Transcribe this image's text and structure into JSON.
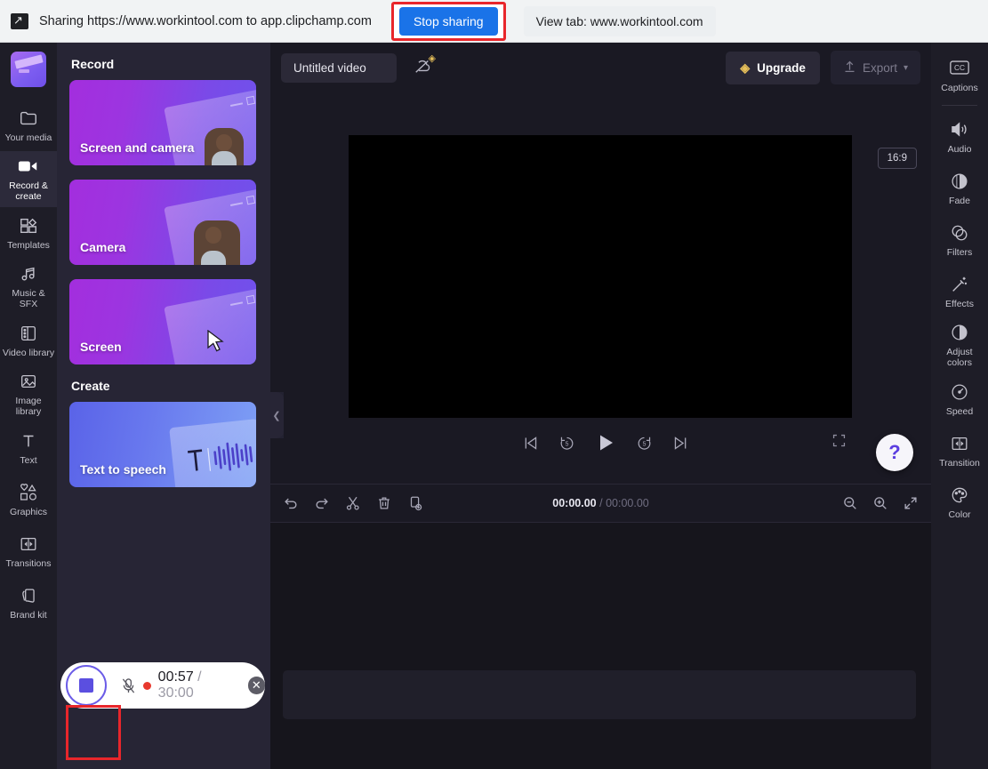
{
  "browser_bar": {
    "share_icon": "screen-share-icon",
    "sharing_text": "Sharing https://www.workintool.com to app.clipchamp.com",
    "stop_sharing_label": "Stop sharing",
    "view_tab_label": "View tab: www.workintool.com",
    "highlight_color": "#e8262b",
    "button_color": "#1a73e8"
  },
  "left_rail": {
    "logo_name": "clipchamp-logo",
    "items": [
      {
        "label": "Your media",
        "icon": "folder-icon",
        "active": false
      },
      {
        "label": "Record &\ncreate",
        "icon": "video-camera-icon",
        "active": true
      },
      {
        "label": "Templates",
        "icon": "templates-icon",
        "active": false
      },
      {
        "label": "Music & SFX",
        "icon": "music-note-icon",
        "active": false
      },
      {
        "label": "Video library",
        "icon": "film-strip-icon",
        "active": false
      },
      {
        "label": "Image\nlibrary",
        "icon": "image-icon",
        "active": false
      },
      {
        "label": "Text",
        "icon": "text-t-icon",
        "active": false
      },
      {
        "label": "Graphics",
        "icon": "shapes-icon",
        "active": false
      },
      {
        "label": "Transitions",
        "icon": "transition-icon",
        "active": false
      },
      {
        "label": "Brand kit",
        "icon": "brand-kit-icon",
        "active": false
      }
    ]
  },
  "panel": {
    "record_heading": "Record",
    "create_heading": "Create",
    "cards": [
      {
        "label": "Screen and camera",
        "art": "screen-and-person"
      },
      {
        "label": "Camera",
        "art": "person"
      },
      {
        "label": "Screen",
        "art": "screen-and-cursor"
      }
    ],
    "create_cards": [
      {
        "label": "Text to speech",
        "art": "text-waveform"
      }
    ],
    "collapse_icon": "chevron-left-icon"
  },
  "topbar": {
    "project_title": "Untitled video",
    "cloud_icon": "cloud-off-icon",
    "cloud_badge_icon": "gem-icon",
    "upgrade_label": "Upgrade",
    "upgrade_icon": "gem-icon",
    "export_label": "Export",
    "export_icon": "upload-arrow-icon",
    "export_chevron": "chevron-down-icon"
  },
  "preview": {
    "aspect_ratio": "16:9",
    "background_color": "#000000"
  },
  "playback": {
    "skip_start_icon": "skip-to-start-icon",
    "back5_icon": "rewind-5-icon",
    "play_icon": "play-icon",
    "fwd5_icon": "forward-5-icon",
    "skip_end_icon": "skip-to-end-icon",
    "fullscreen_icon": "fullscreen-icon"
  },
  "help": {
    "icon": "question-mark-icon",
    "label": "?"
  },
  "timeline_toolbar": {
    "undo_icon": "undo-icon",
    "redo_icon": "redo-icon",
    "split_icon": "scissors-icon",
    "delete_icon": "trash-icon",
    "duplicate_icon": "add-clip-icon",
    "current_time": "00:00.00",
    "separator": "/",
    "total_time": "00:00.00",
    "zoom_out_icon": "zoom-out-icon",
    "zoom_in_icon": "zoom-in-icon",
    "fit_icon": "fit-to-screen-icon"
  },
  "center_collapse_icon": "chevron-left-icon",
  "right_rail": {
    "items": [
      {
        "label": "Captions",
        "icon": "cc-icon"
      },
      {
        "label": "Audio",
        "icon": "speaker-icon"
      },
      {
        "label": "Fade",
        "icon": "fade-icon"
      },
      {
        "label": "Filters",
        "icon": "filters-icon"
      },
      {
        "label": "Effects",
        "icon": "magic-wand-icon"
      },
      {
        "label": "Adjust\ncolors",
        "icon": "contrast-icon"
      },
      {
        "label": "Speed",
        "icon": "speedometer-icon"
      },
      {
        "label": "Transition",
        "icon": "transition-icon"
      },
      {
        "label": "Color",
        "icon": "palette-icon"
      }
    ]
  },
  "recording_pill": {
    "stop_icon": "stop-square-icon",
    "mic_icon": "mic-muted-icon",
    "rec_dot": "recording-dot",
    "elapsed": "00:57",
    "separator": "/",
    "limit": "30:00",
    "close_icon": "close-icon",
    "highlight_color": "#e8262b",
    "accent_color": "#5b4fe0"
  }
}
